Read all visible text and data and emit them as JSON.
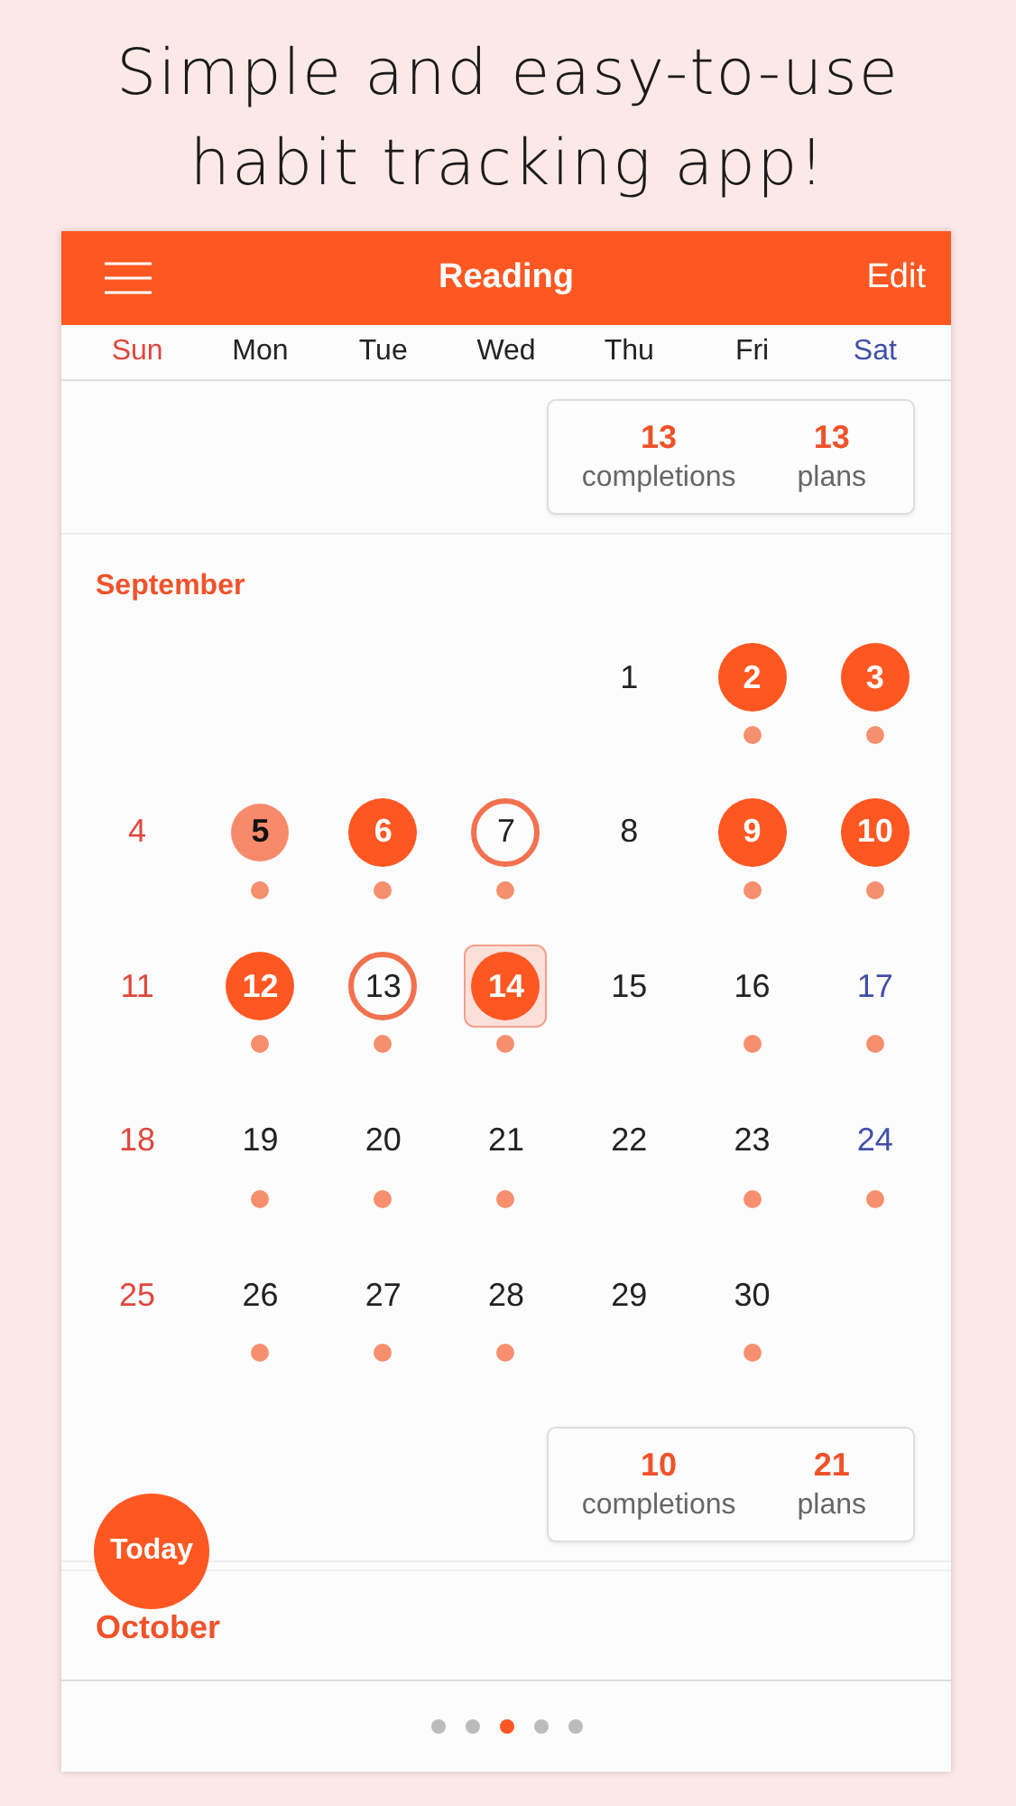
{
  "headline": [
    "Simple and easy-to-use",
    "habit tracking app!"
  ],
  "app_bar": {
    "title": "Reading",
    "action": "Edit"
  },
  "weekdays": [
    {
      "label": "Sun",
      "color": "#e0463c"
    },
    {
      "label": "Mon",
      "color": "#222222"
    },
    {
      "label": "Tue",
      "color": "#222222"
    },
    {
      "label": "Wed",
      "color": "#222222"
    },
    {
      "label": "Thu",
      "color": "#222222"
    },
    {
      "label": "Fri",
      "color": "#222222"
    },
    {
      "label": "Sat",
      "color": "#3f4fa8"
    }
  ],
  "top_summary": {
    "completions": "13",
    "completions_label": "completions",
    "plans": "13",
    "plans_label": "plans"
  },
  "month": {
    "name": "September",
    "weeks": [
      [
        {
          "kind": "empty"
        },
        {
          "kind": "empty"
        },
        {
          "kind": "empty"
        },
        {
          "kind": "empty"
        },
        {
          "kind": "plain",
          "day": "1",
          "planned": false,
          "selected": false
        },
        {
          "kind": "done",
          "day": "2",
          "planned": true,
          "selected": false
        },
        {
          "kind": "done",
          "day": "3",
          "planned": true,
          "selected": false
        }
      ],
      [
        {
          "kind": "plain",
          "day": "4",
          "planned": false,
          "selected": false
        },
        {
          "kind": "partial",
          "day": "5",
          "planned": true,
          "selected": false
        },
        {
          "kind": "done",
          "day": "6",
          "planned": true,
          "selected": false
        },
        {
          "kind": "ring",
          "day": "7",
          "planned": true,
          "selected": false
        },
        {
          "kind": "plain",
          "day": "8",
          "planned": false,
          "selected": false
        },
        {
          "kind": "done",
          "day": "9",
          "planned": true,
          "selected": false
        },
        {
          "kind": "done",
          "day": "10",
          "planned": true,
          "selected": false
        }
      ],
      [
        {
          "kind": "plain",
          "day": "11",
          "planned": false,
          "selected": false
        },
        {
          "kind": "done",
          "day": "12",
          "planned": true,
          "selected": false
        },
        {
          "kind": "ring",
          "day": "13",
          "planned": true,
          "selected": false
        },
        {
          "kind": "done",
          "day": "14",
          "planned": true,
          "selected": true
        },
        {
          "kind": "plain",
          "day": "15",
          "planned": false,
          "selected": false
        },
        {
          "kind": "plain",
          "day": "16",
          "planned": true,
          "selected": false
        },
        {
          "kind": "plain",
          "day": "17",
          "planned": true,
          "selected": false
        }
      ],
      [
        {
          "kind": "plain",
          "day": "18",
          "planned": false,
          "selected": false
        },
        {
          "kind": "plain",
          "day": "19",
          "planned": true,
          "selected": false
        },
        {
          "kind": "plain",
          "day": "20",
          "planned": true,
          "selected": false
        },
        {
          "kind": "plain",
          "day": "21",
          "planned": true,
          "selected": false
        },
        {
          "kind": "plain",
          "day": "22",
          "planned": false,
          "selected": false
        },
        {
          "kind": "plain",
          "day": "23",
          "planned": true,
          "selected": false
        },
        {
          "kind": "plain",
          "day": "24",
          "planned": true,
          "selected": false
        }
      ],
      [
        {
          "kind": "plain",
          "day": "25",
          "planned": false,
          "selected": false
        },
        {
          "kind": "plain",
          "day": "26",
          "planned": true,
          "selected": false
        },
        {
          "kind": "plain",
          "day": "27",
          "planned": true,
          "selected": false
        },
        {
          "kind": "plain",
          "day": "28",
          "planned": true,
          "selected": false
        },
        {
          "kind": "plain",
          "day": "29",
          "planned": false,
          "selected": false
        },
        {
          "kind": "plain",
          "day": "30",
          "planned": true,
          "selected": false
        },
        {
          "kind": "empty"
        }
      ]
    ],
    "summary": {
      "completions": "10",
      "completions_label": "completions",
      "plans": "21",
      "plans_label": "plans"
    }
  },
  "next_month": "October",
  "today_button": "Today",
  "page_dots": [
    {
      "selected": false
    },
    {
      "selected": false
    },
    {
      "selected": true
    },
    {
      "selected": false
    },
    {
      "selected": false
    }
  ]
}
